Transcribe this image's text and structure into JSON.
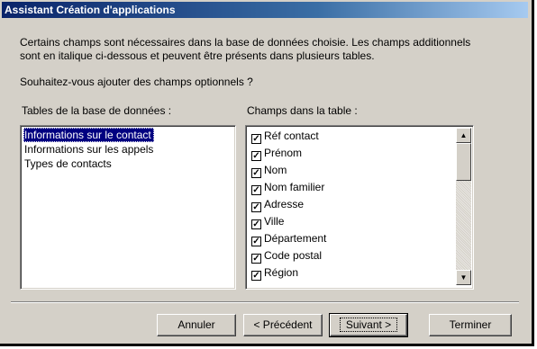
{
  "window": {
    "title": "Assistant Création d'applications"
  },
  "intro": {
    "line1": "Certains champs sont nécessaires dans la base de données choisie. Les champs additionnels",
    "line2": "sont en italique ci-dessous et peuvent être présents dans plusieurs tables.",
    "question": "Souhaitez-vous ajouter des champs optionnels ?"
  },
  "tables": {
    "label": "Tables de la base de données :",
    "items": [
      "Informations sur le contact",
      "Informations sur les appels",
      "Types de contacts"
    ],
    "selected": "Informations sur le contact"
  },
  "fields": {
    "label": "Champs dans la table :",
    "items": [
      {
        "label": "Réf contact",
        "checked": true
      },
      {
        "label": "Prénom",
        "checked": true
      },
      {
        "label": "Nom",
        "checked": true
      },
      {
        "label": "Nom familier",
        "checked": true
      },
      {
        "label": "Adresse",
        "checked": true
      },
      {
        "label": "Ville",
        "checked": true
      },
      {
        "label": "Département",
        "checked": true
      },
      {
        "label": "Code postal",
        "checked": true
      },
      {
        "label": "Région",
        "checked": true
      }
    ],
    "check_mark": "✓"
  },
  "buttons": {
    "cancel": "Annuler",
    "previous": "< Précédent",
    "next": "Suivant >",
    "finish": "Terminer"
  },
  "icons": {
    "scroll_up": "▲",
    "scroll_down": "▼"
  }
}
